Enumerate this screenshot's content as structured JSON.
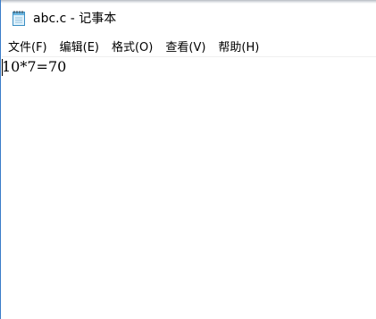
{
  "window": {
    "title": "abc.c - 记事本",
    "icon": "notepad-icon"
  },
  "menu": {
    "items": [
      {
        "label": "文件(F)"
      },
      {
        "label": "编辑(E)"
      },
      {
        "label": "格式(O)"
      },
      {
        "label": "查看(V)"
      },
      {
        "label": "帮助(H)"
      }
    ]
  },
  "editor": {
    "content": "10*7=70"
  },
  "colors": {
    "window_border": "#3a7cc9",
    "background": "#ffffff",
    "text": "#000000"
  }
}
